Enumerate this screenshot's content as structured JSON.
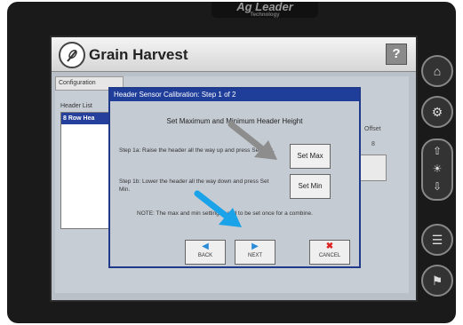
{
  "brand": {
    "name": "Ag Leader",
    "tagline": "Technology"
  },
  "app": {
    "title": "Grain Harvest",
    "help_label": "?"
  },
  "background": {
    "tab_label": "Configuration",
    "header_list_label": "Header List",
    "header_list_item": "8 Row Hea",
    "right_label": "Offset",
    "right_value": "8"
  },
  "dialog": {
    "title": "Header Sensor Calibration: Step 1 of 2",
    "heading": "Set Maximum and Minimum Header Height",
    "step1_text": "Step 1a: Raise the header all the way up and press Set Max.",
    "step2_text": "Step 1b: Lower the header all the way down and press Set Min.",
    "set_max_label": "Set Max",
    "set_min_label": "Set Min",
    "note_text": "NOTE: The max and min settings need to be set once for a combine.",
    "back_label": "BACK",
    "next_label": "NEXT",
    "cancel_label": "CANCEL",
    "back_icon": "◀",
    "next_icon": "▶",
    "cancel_icon": "✖"
  },
  "side_buttons": {
    "home_icon": "⌂",
    "settings_icon": "⚙",
    "brightness_up": "⇧",
    "brightness_sun": "☀",
    "brightness_down": "⇩",
    "notes_icon": "☰",
    "runner_icon": "⚑"
  },
  "colors": {
    "dialog_title_bg": "#1f3e9a",
    "annotation_gray": "#8d8d8d",
    "annotation_blue": "#1aa3e8"
  }
}
